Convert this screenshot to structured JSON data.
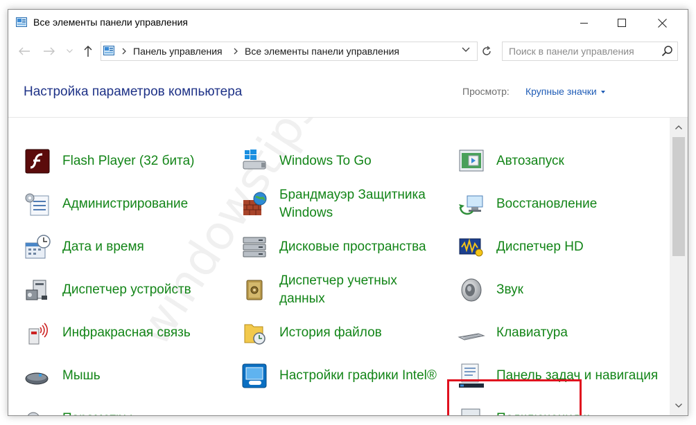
{
  "window": {
    "title": "Все элементы панели управления"
  },
  "address": {
    "crumbs": [
      "Панель управления",
      "Все элементы панели управления"
    ],
    "search_placeholder": "Поиск в панели управления"
  },
  "header": {
    "title": "Настройка параметров компьютера",
    "view_label": "Просмотр:",
    "view_value": "Крупные значки"
  },
  "items": [
    {
      "label": "Flash Player (32 бита)",
      "icon": "flash-player-icon"
    },
    {
      "label": "Windows To Go",
      "icon": "windows-to-go-icon"
    },
    {
      "label": "Автозапуск",
      "icon": "autoplay-icon"
    },
    {
      "label": "Администрирование",
      "icon": "administrative-tools-icon"
    },
    {
      "label": "Брандмауэр Защитника Windows",
      "icon": "firewall-icon"
    },
    {
      "label": "Восстановление",
      "icon": "recovery-icon"
    },
    {
      "label": "Дата и время",
      "icon": "date-time-icon"
    },
    {
      "label": "Дисковые пространства",
      "icon": "storage-spaces-icon"
    },
    {
      "label": "Диспетчер HD",
      "icon": "hd-audio-manager-icon"
    },
    {
      "label": "Диспетчер устройств",
      "icon": "device-manager-icon"
    },
    {
      "label": "Диспетчер учетных данных",
      "icon": "credential-manager-icon"
    },
    {
      "label": "Звук",
      "icon": "speaker-icon"
    },
    {
      "label": "Инфракрасная связь",
      "icon": "infrared-icon"
    },
    {
      "label": "История файлов",
      "icon": "file-history-icon"
    },
    {
      "label": "Клавиатура",
      "icon": "keyboard-icon"
    },
    {
      "label": "Мышь",
      "icon": "mouse-icon"
    },
    {
      "label": "Настройки графики Intel®",
      "icon": "intel-graphics-icon"
    },
    {
      "label": "Панель задач и навигация",
      "icon": "taskbar-icon"
    },
    {
      "label": "Параметры",
      "icon": "options-icon"
    },
    {
      "label": "",
      "icon": "partial-item-icon"
    },
    {
      "label": "Подключения к",
      "icon": "connections-icon"
    }
  ],
  "watermark": "windowstips.ru",
  "colors": {
    "link_green": "#138518",
    "header_blue": "#1e3287",
    "highlight_red": "#e0101e"
  }
}
